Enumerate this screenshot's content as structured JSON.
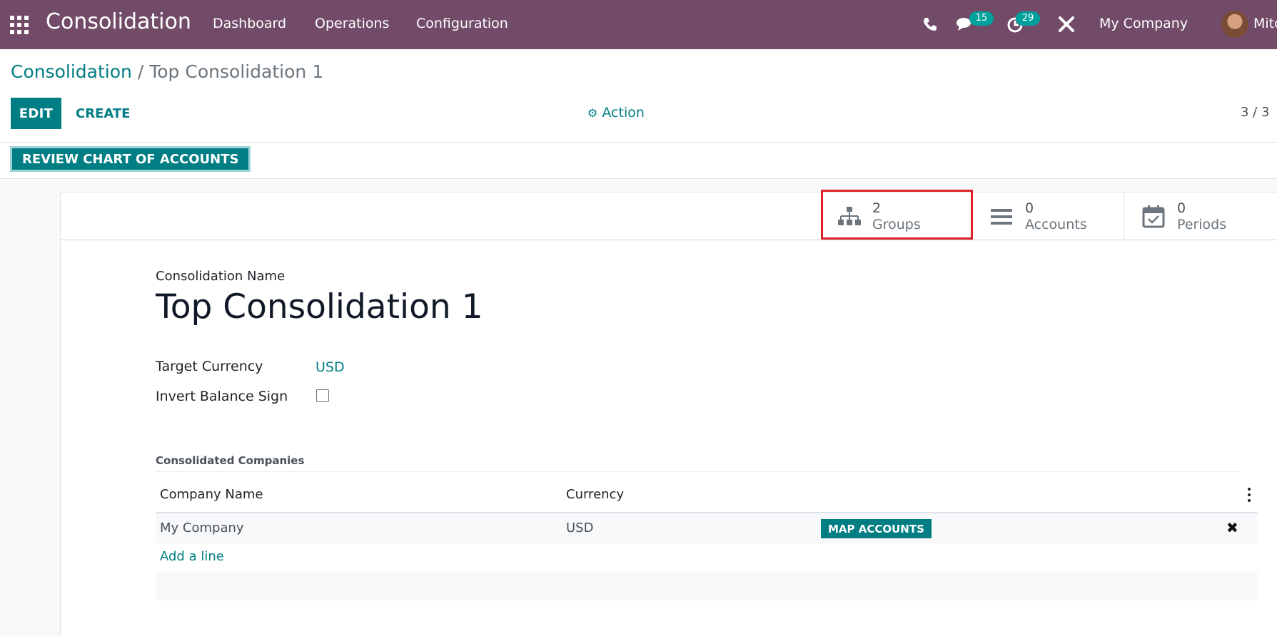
{
  "navbar": {
    "app_name": "Consolidation",
    "menu": [
      "Dashboard",
      "Operations",
      "Configuration"
    ],
    "messages_count": "15",
    "activities_count": "29",
    "company": "My Company",
    "user": "Mitc",
    "icons": [
      "apps-grid-icon",
      "phone-icon",
      "chat-icon",
      "activity-clock-icon",
      "tools-icon"
    ]
  },
  "breadcrumb": {
    "parent": "Consolidation",
    "separator": "/",
    "current": "Top Consolidation 1"
  },
  "controls": {
    "edit": "EDIT",
    "create": "CREATE",
    "action": "Action",
    "pager": "3 / 3"
  },
  "statusbar": {
    "review_button": "REVIEW CHART OF ACCOUNTS"
  },
  "stats": [
    {
      "value": "2",
      "label": "Groups",
      "icon": "sitemap-icon"
    },
    {
      "value": "0",
      "label": "Accounts",
      "icon": "list-icon"
    },
    {
      "value": "0",
      "label": "Periods",
      "icon": "calendar-check-icon"
    }
  ],
  "form": {
    "name_label": "Consolidation Name",
    "name_value": "Top Consolidation 1",
    "currency_label": "Target Currency",
    "currency_value": "USD",
    "invert_label": "Invert Balance Sign",
    "invert_checked": false,
    "section_title": "Consolidated Companies"
  },
  "companies_table": {
    "headers": [
      "Company Name",
      "Currency"
    ],
    "rows": [
      {
        "company": "My Company",
        "currency": "USD",
        "action": "MAP ACCOUNTS"
      }
    ],
    "add_line": "Add a line"
  },
  "colors": {
    "navbar": "#714b67",
    "primary": "#017e84",
    "highlight": "#e0202a"
  }
}
